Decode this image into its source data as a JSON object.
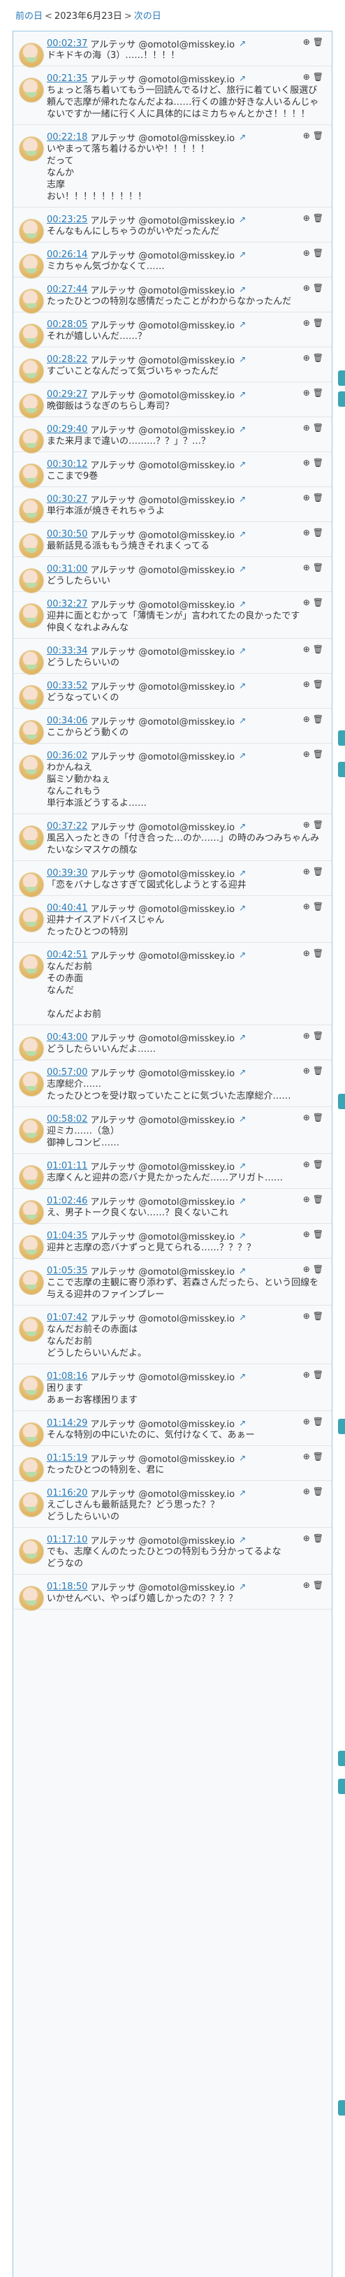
{
  "nav": {
    "prev_label": "前の日",
    "date": "2023年6月23日",
    "next_label": "次の日"
  },
  "author": "アルテッサ @omotol@misskey.io",
  "icons": {
    "link": "external-link-icon",
    "reply": "reply-icon",
    "delete": "trash-icon"
  },
  "accent": "#2a7ab7",
  "posts": [
    {
      "time": "00:02:37",
      "text": "ドキドキの海（3）……！！！！"
    },
    {
      "time": "00:21:35",
      "text": "ちょっと落ち着いてもう一回読んでるけど、旅行に着ていく服選び頼んで志摩が帰れたなんだよね……行くの誰か好きな人いるんじゃないですか一緒に行く人に具体的にはミカちゃんとかさ！！！！"
    },
    {
      "time": "00:22:18",
      "text": "いやまって落ち着けるかいや！！！！！\nだって\nなんか\n志摩\nおい！！！！！！！！！"
    },
    {
      "time": "00:23:25",
      "text": "そんなもんにしちゃうのがいやだったんだ"
    },
    {
      "time": "00:26:14",
      "text": "ミカちゃん気づかなくて……"
    },
    {
      "time": "00:27:44",
      "text": "たったひとつの特別な感情だったことがわからなかったんだ"
    },
    {
      "time": "00:28:05",
      "text": "それが嬉しいんだ……？"
    },
    {
      "time": "00:28:22",
      "text": "すごいことなんだって気づいちゃったんだ"
    },
    {
      "time": "00:29:27",
      "text": "晩御飯はうなぎのちらし寿司？"
    },
    {
      "time": "00:29:40",
      "text": "また来月まで違いの………？？」？…？"
    },
    {
      "time": "00:30:12",
      "text": "ここまで9巻"
    },
    {
      "time": "00:30:27",
      "text": "単行本派が焼きそれちゃうよ"
    },
    {
      "time": "00:30:50",
      "text": "最新話見る派ももう焼きそれまくってる"
    },
    {
      "time": "00:31:00",
      "text": "どうしたらいい"
    },
    {
      "time": "00:32:27",
      "text": "迎井に面とむかって「薄情モンが」言われてたの良かったです\n仲良くなれよみんな"
    },
    {
      "time": "00:33:34",
      "text": "どうしたらいいの"
    },
    {
      "time": "00:33:52",
      "text": "どうなっていくの"
    },
    {
      "time": "00:34:06",
      "text": "ここからどう動くの"
    },
    {
      "time": "00:36:02",
      "text": "わかんねえ\n脳ミソ動かねぇ\nなんこれもう\n単行本派どうするよ……"
    },
    {
      "time": "00:37:22",
      "text": "風呂入ったときの「付き合った…のか……」の時のみつみちゃんみたいなシマスケの顔な"
    },
    {
      "time": "00:39:30",
      "text": "「恋をバナしなさすぎて図式化しようとする迎井"
    },
    {
      "time": "00:40:41",
      "text": "迎井ナイスアドバイスじゃん\nたったひとつの特別"
    },
    {
      "time": "00:42:51",
      "text": "なんだお前\nその赤面\nなんだ\n\nなんだよお前"
    },
    {
      "time": "00:43:00",
      "text": "どうしたらいいんだよ……"
    },
    {
      "time": "00:57:00",
      "text": "志摩総介……\nたったひとつを受け取っていたことに気づいた志摩総介……"
    },
    {
      "time": "00:58:02",
      "text": "迎ミカ……（急）\n御神しコンビ……"
    },
    {
      "time": "01:01:11",
      "text": "志摩くんと迎井の恋バナ見たかったんだ……アリガト……"
    },
    {
      "time": "01:02:46",
      "text": "え、男子トーク良くない……？良くないこれ"
    },
    {
      "time": "01:04:35",
      "text": "迎井と志摩の恋バナずっと見てられる……？？？？"
    },
    {
      "time": "01:05:35",
      "text": "ここで志摩の主観に寄り添わず、若森さんだったら、という回線を与える迎井のファインプレー"
    },
    {
      "time": "01:07:42",
      "text": "なんだお前その赤面は\nなんだお前\nどうしたらいいんだよ。"
    },
    {
      "time": "01:08:16",
      "text": "困ります\nあぁーお客様困ります"
    },
    {
      "time": "01:14:29",
      "text": "そんな特別の中にいたのに、気付けなくて、あぁー"
    },
    {
      "time": "01:15:19",
      "text": "たったひとつの特別を、君に"
    },
    {
      "time": "01:16:20",
      "text": "えごしさんも最新話見た？どう思った？？\nどうしたらいいの"
    },
    {
      "time": "01:17:10",
      "text": "でも、志摩くんのたったひとつの特別もう分かってるよな\nどうなの"
    },
    {
      "time": "01:18:50",
      "text": "いかせんべい、やっぱり嬉しかったの？？？？"
    }
  ]
}
